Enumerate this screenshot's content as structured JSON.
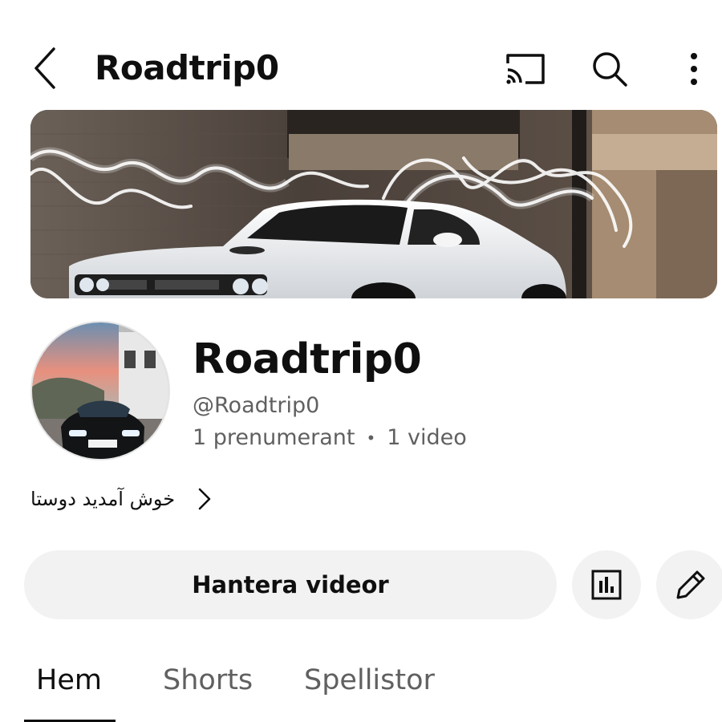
{
  "header": {
    "title": "Roadtrip0",
    "back_icon": "chevron-left-icon",
    "cast_icon": "cast-icon",
    "search_icon": "search-icon",
    "more_icon": "more-vertical-icon"
  },
  "channel": {
    "name": "Roadtrip0",
    "handle": "@Roadtrip0",
    "subscribers": "1 prenumerant",
    "separator": "•",
    "videos": "1 video",
    "description": "خوش آمدید دوستا"
  },
  "actions": {
    "manage_label": "Hantera videor",
    "analytics_icon": "analytics-icon",
    "edit_icon": "pencil-icon"
  },
  "tabs": [
    {
      "label": "Hem",
      "selected": true
    },
    {
      "label": "Shorts",
      "selected": false
    },
    {
      "label": "Spellistor",
      "selected": false
    }
  ],
  "colors": {
    "text_primary": "#0f0f0f",
    "text_secondary": "#606060",
    "button_bg": "#f2f2f2"
  }
}
